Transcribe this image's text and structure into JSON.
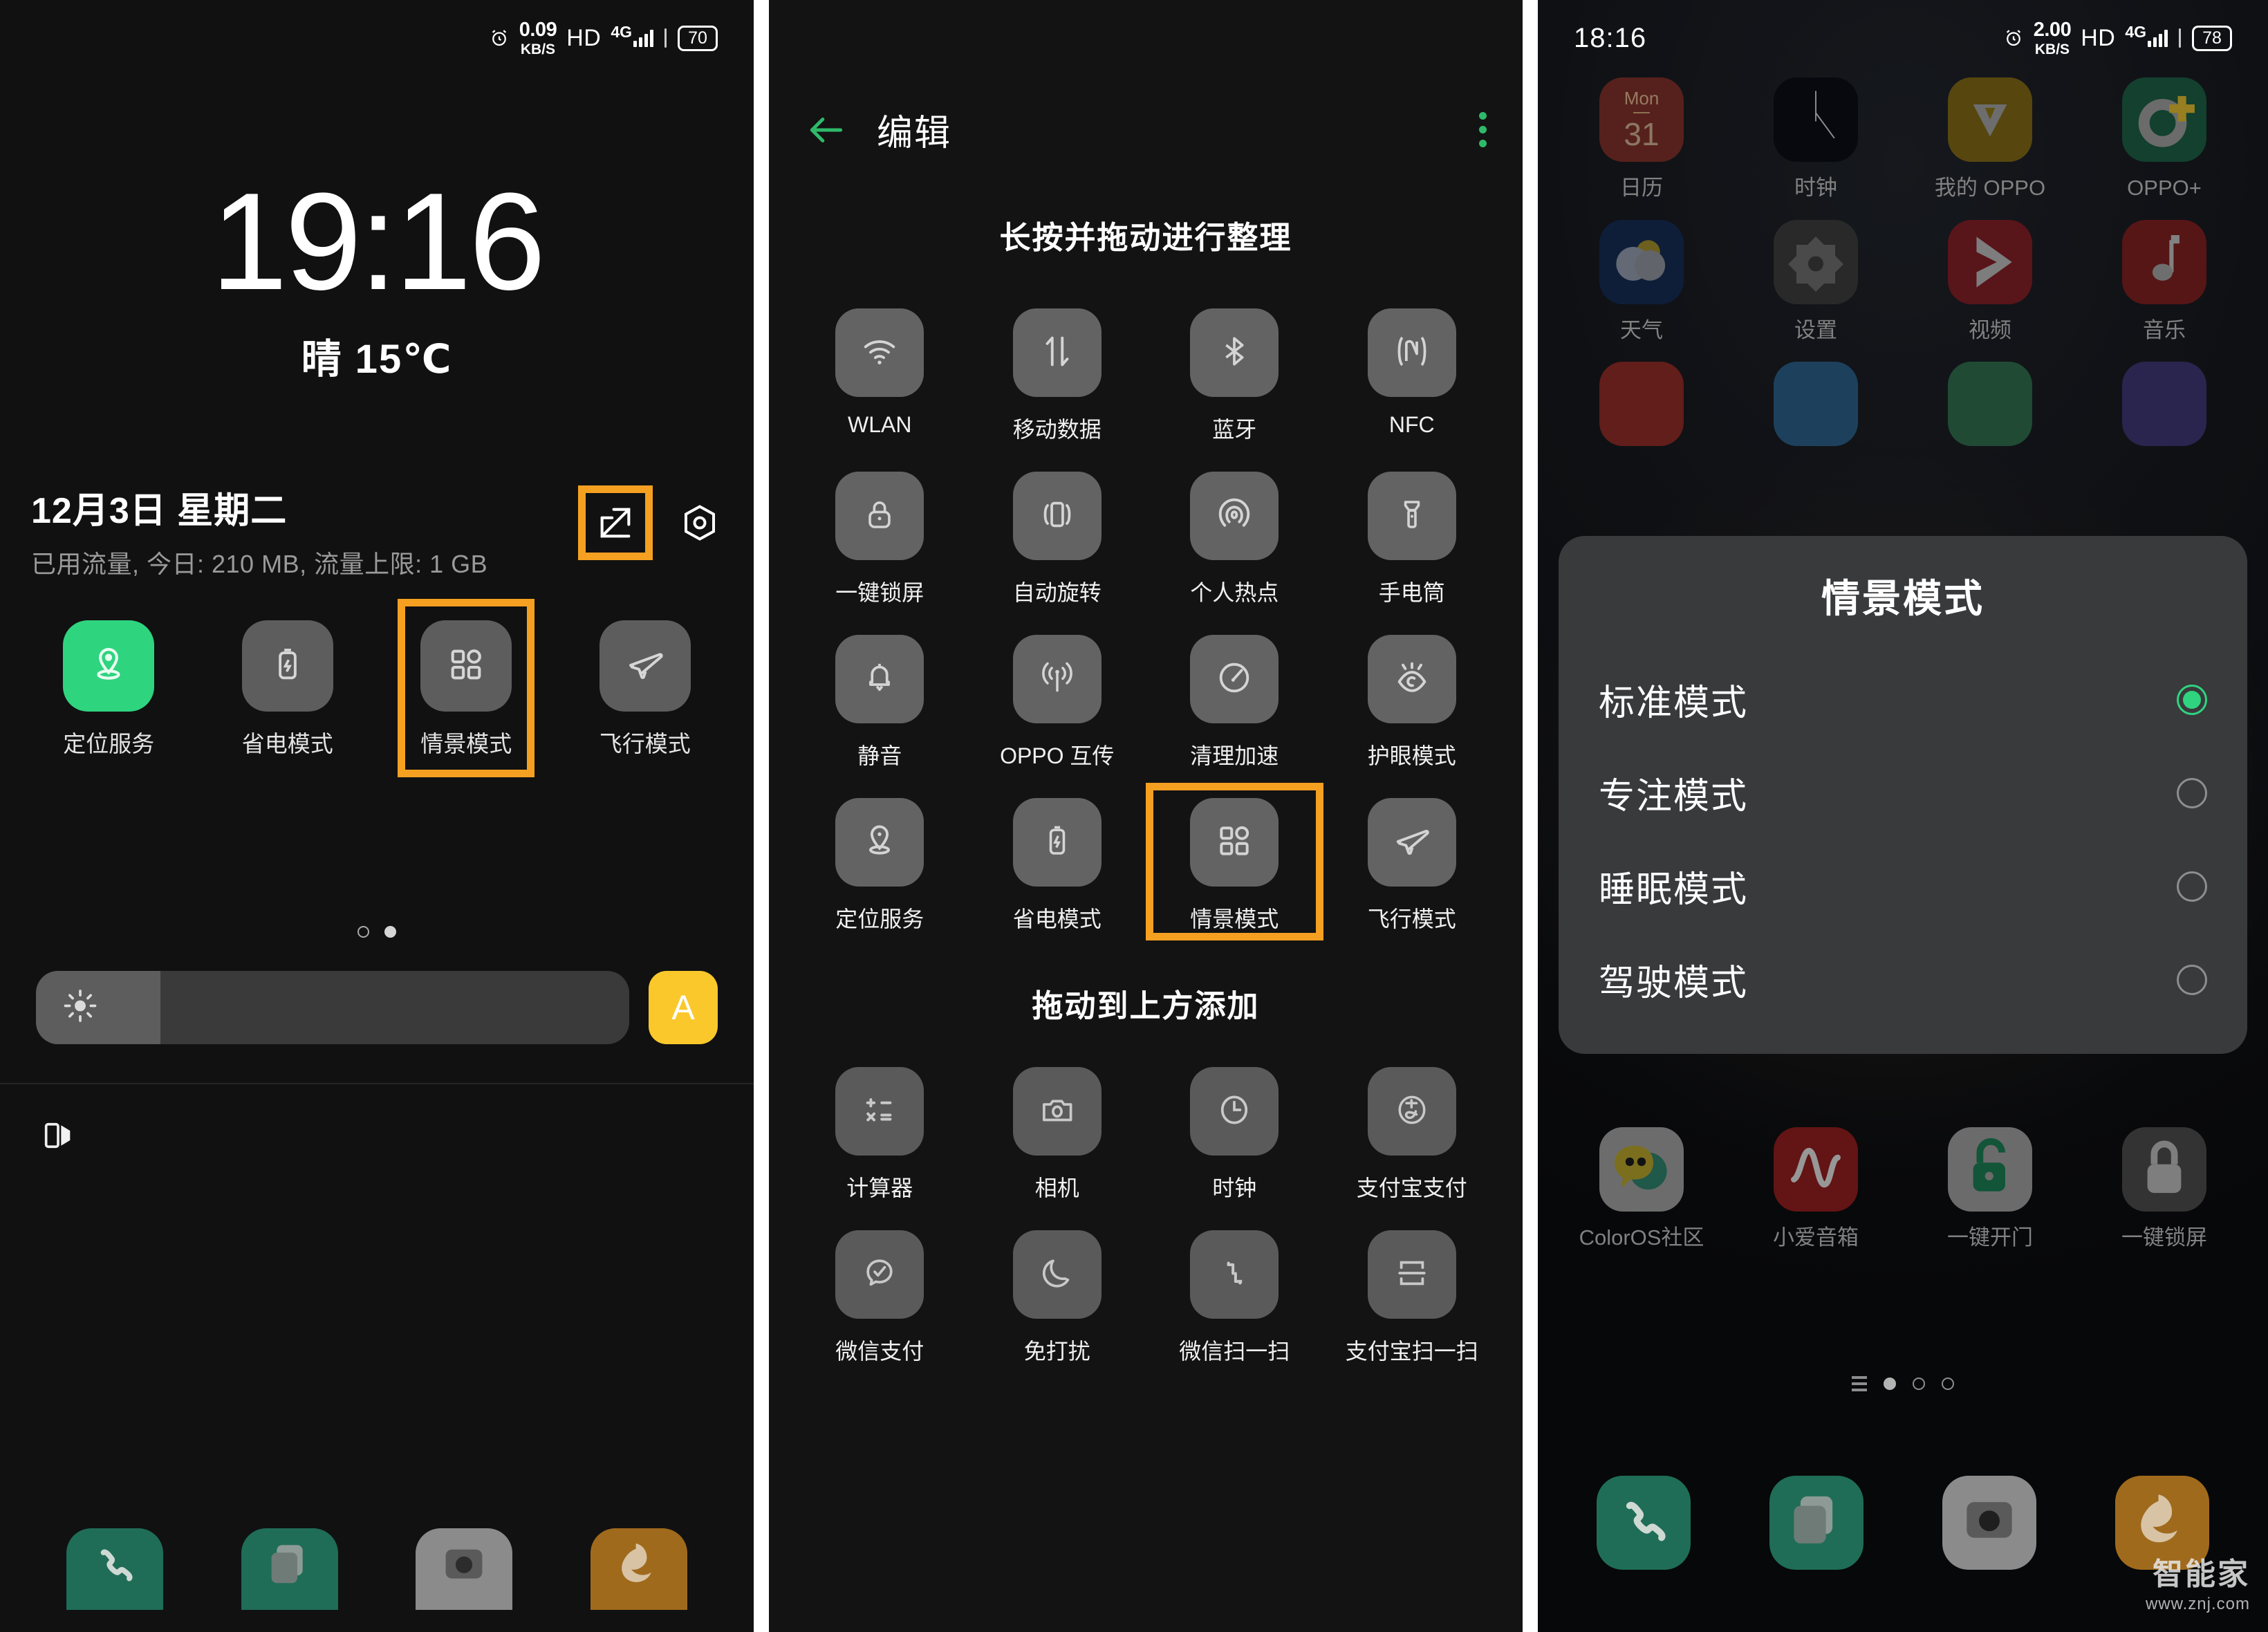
{
  "panel1": {
    "status": {
      "alarm_icon": "alarm-icon",
      "speed_value": "0.09",
      "speed_unit": "KB/S",
      "hd": "HD",
      "network": "4G",
      "battery": "70"
    },
    "clock": "19:16",
    "weather": "晴 15℃",
    "date": "12月3日  星期二",
    "traffic": "已用流量,  今日: 210 MB,  流量上限: 1 GB",
    "header_icons": [
      {
        "name": "edit-icon",
        "highlighted": true
      },
      {
        "name": "settings-hex-icon",
        "highlighted": false
      }
    ],
    "quick_toggles": [
      {
        "label": "定位服务",
        "icon": "location-icon",
        "active": true,
        "highlighted": false
      },
      {
        "label": "省电模式",
        "icon": "battery-saver-icon",
        "active": false,
        "highlighted": false
      },
      {
        "label": "情景模式",
        "icon": "scene-mode-icon",
        "active": false,
        "highlighted": true
      },
      {
        "label": "飞行模式",
        "icon": "airplane-icon",
        "active": false,
        "highlighted": false
      }
    ],
    "page_dots": {
      "count": 2,
      "active_index": 1
    },
    "brightness": {
      "icon": "brightness-sun-icon",
      "level_percent": 16,
      "auto_label": "A"
    },
    "bottom_icon": "flip-screen-icon",
    "dock": [
      "phone-icon",
      "messages-icon",
      "camera-icon",
      "uc-browser-icon"
    ]
  },
  "panel2": {
    "back_icon": "back-arrow-icon",
    "title": "编辑",
    "menu_icon": "kebab-menu-icon",
    "subtitle_top": "长按并拖动进行整理",
    "subtitle_bottom": "拖动到上方添加",
    "active_tiles": [
      {
        "label": "WLAN",
        "icon": "wifi-icon",
        "highlighted": false
      },
      {
        "label": "移动数据",
        "icon": "mobile-data-icon",
        "highlighted": false
      },
      {
        "label": "蓝牙",
        "icon": "bluetooth-icon",
        "highlighted": false
      },
      {
        "label": "NFC",
        "icon": "nfc-icon",
        "highlighted": false
      },
      {
        "label": "一键锁屏",
        "icon": "lock-icon",
        "highlighted": false
      },
      {
        "label": "自动旋转",
        "icon": "auto-rotate-icon",
        "highlighted": false
      },
      {
        "label": "个人热点",
        "icon": "hotspot-icon",
        "highlighted": false
      },
      {
        "label": "手电筒",
        "icon": "flashlight-icon",
        "highlighted": false
      },
      {
        "label": "静音",
        "icon": "bell-mute-icon",
        "highlighted": false
      },
      {
        "label": "OPPO 互传",
        "icon": "oppo-share-icon",
        "highlighted": false
      },
      {
        "label": "清理加速",
        "icon": "speed-clean-icon",
        "highlighted": false
      },
      {
        "label": "护眼模式",
        "icon": "eye-care-icon",
        "highlighted": false
      },
      {
        "label": "定位服务",
        "icon": "location-icon",
        "highlighted": false
      },
      {
        "label": "省电模式",
        "icon": "battery-saver-icon",
        "highlighted": false
      },
      {
        "label": "情景模式",
        "icon": "scene-mode-icon",
        "highlighted": true
      },
      {
        "label": "飞行模式",
        "icon": "airplane-icon",
        "highlighted": false
      }
    ],
    "available_tiles": [
      {
        "label": "计算器",
        "icon": "calculator-icon"
      },
      {
        "label": "相机",
        "icon": "camera-icon"
      },
      {
        "label": "时钟",
        "icon": "clock-icon"
      },
      {
        "label": "支付宝支付",
        "icon": "alipay-pay-icon"
      },
      {
        "label": "微信支付",
        "icon": "wechat-pay-icon"
      },
      {
        "label": "免打扰",
        "icon": "dnd-moon-icon"
      },
      {
        "label": "微信扫一扫",
        "icon": "wechat-scan-icon"
      },
      {
        "label": "支付宝扫一扫",
        "icon": "alipay-scan-icon"
      }
    ]
  },
  "panel3": {
    "status": {
      "time": "18:16",
      "alarm_icon": "alarm-icon",
      "speed_value": "2.00",
      "speed_unit": "KB/S",
      "hd": "HD",
      "network": "4G",
      "battery": "78"
    },
    "app_rows": [
      [
        {
          "label": "日历",
          "icon": "calendar-icon",
          "day_name": "Mon",
          "day_num": "31"
        },
        {
          "label": "时钟",
          "icon": "analog-clock-icon"
        },
        {
          "label": "我的 OPPO",
          "icon": "my-oppo-icon"
        },
        {
          "label": "OPPO+",
          "icon": "oppo-plus-icon"
        }
      ],
      [
        {
          "label": "天气",
          "icon": "weather-icon"
        },
        {
          "label": "设置",
          "icon": "settings-gear-icon"
        },
        {
          "label": "视频",
          "icon": "video-icon"
        },
        {
          "label": "音乐",
          "icon": "music-icon"
        }
      ],
      [
        {
          "label": "ColorOS社区",
          "icon": "coloros-community-icon"
        },
        {
          "label": "小爱音箱",
          "icon": "xiaoai-speaker-icon"
        },
        {
          "label": "一键开门",
          "icon": "unlock-door-icon"
        },
        {
          "label": "一键锁屏",
          "icon": "lock-screen-icon"
        }
      ]
    ],
    "dialog": {
      "title": "情景模式",
      "options": [
        {
          "label": "标准模式",
          "selected": true
        },
        {
          "label": "专注模式",
          "selected": false
        },
        {
          "label": "睡眠模式",
          "selected": false
        },
        {
          "label": "驾驶模式",
          "selected": false
        }
      ]
    },
    "pager": {
      "menu_icon": "pager-menu-icon",
      "dots": 3,
      "active_index": 0
    },
    "dock": [
      "phone-icon",
      "messages-icon",
      "camera-icon",
      "uc-browser-icon"
    ],
    "watermark": {
      "line1": "智能家",
      "line2": "www.znj.com"
    }
  },
  "colors": {
    "accent_green": "#2fd47f",
    "highlight_orange": "#f5a021",
    "auto_yellow": "#fbc82b",
    "tile_grey": "#636363"
  }
}
